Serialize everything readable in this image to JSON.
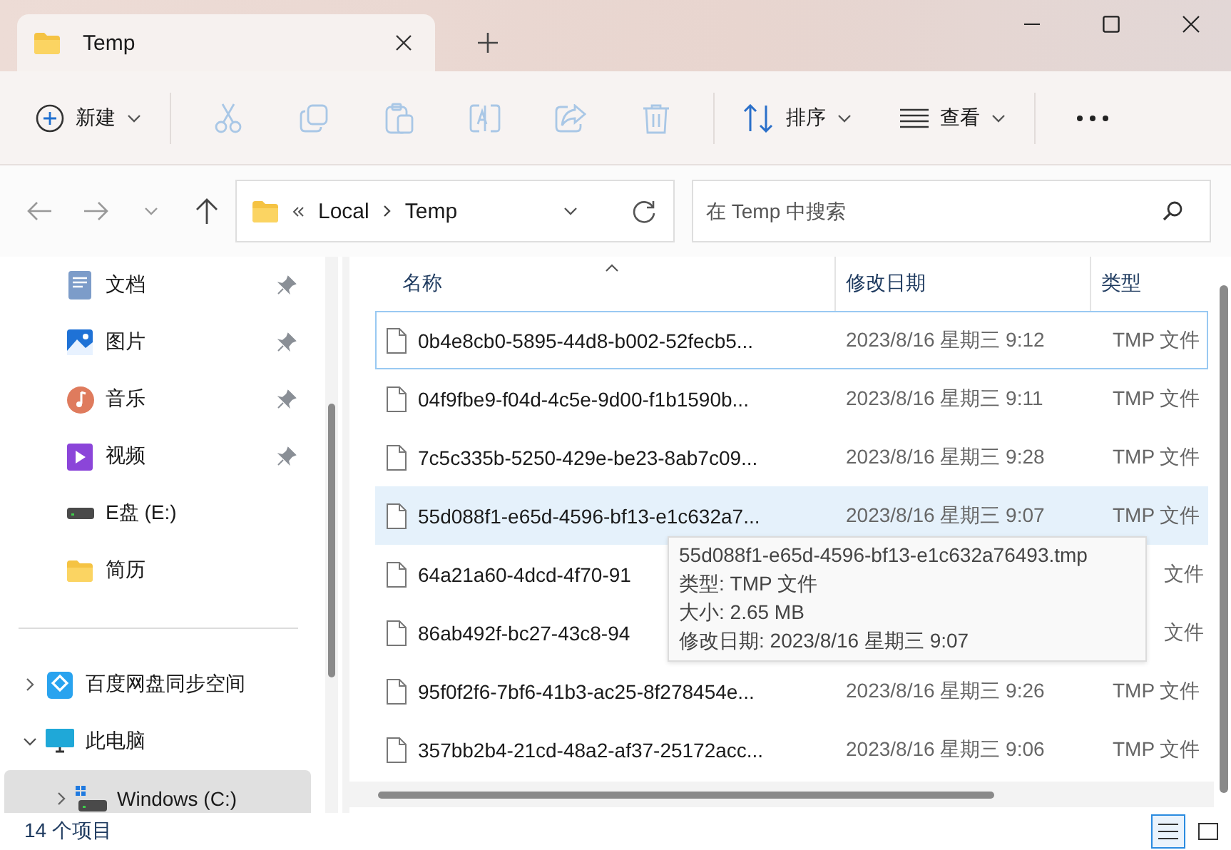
{
  "tabs": [
    {
      "label": "Temp",
      "selected": true
    }
  ],
  "toolbar": {
    "new": {
      "label": "新建"
    },
    "actions": [
      {
        "kind": "cut",
        "disabled": true
      },
      {
        "kind": "copy",
        "disabled": true
      },
      {
        "kind": "paste",
        "disabled": true
      },
      {
        "kind": "rename",
        "disabled": true
      },
      {
        "kind": "share",
        "disabled": true
      },
      {
        "kind": "delete",
        "disabled": true
      }
    ],
    "sort": {
      "label": "排序"
    },
    "view": {
      "label": "查看"
    }
  },
  "address": {
    "crumbs": [
      "Local",
      "Temp"
    ]
  },
  "search": {
    "placeholder": "在 Temp 中搜索"
  },
  "sidebar": {
    "groups": [
      {
        "items": [
          {
            "kind": "documents",
            "label": "文档",
            "pinned": true,
            "selected": false
          },
          {
            "kind": "pictures",
            "label": "图片",
            "pinned": true,
            "selected": false
          },
          {
            "kind": "music",
            "label": "音乐",
            "pinned": true,
            "selected": false
          },
          {
            "kind": "videos",
            "label": "视频",
            "pinned": true,
            "selected": false
          },
          {
            "kind": "drive",
            "label": "E盘 (E:)",
            "pinned": false,
            "selected": false
          },
          {
            "kind": "folder",
            "label": "简历",
            "pinned": false,
            "selected": false
          }
        ]
      },
      {
        "items": [
          {
            "kind": "cloud",
            "label": "百度网盘同步空间",
            "expanded": false,
            "selected": false
          },
          {
            "kind": "computer",
            "label": "此电脑",
            "expanded": true,
            "selected": false,
            "children": [
              {
                "kind": "windows-drive",
                "label": "Windows (C:)",
                "expanded": false,
                "selected": true
              }
            ]
          }
        ]
      }
    ]
  },
  "columns": [
    {
      "label": "名称",
      "sorted": true
    },
    {
      "label": "修改日期",
      "sorted": false
    },
    {
      "label": "类型",
      "sorted": false
    }
  ],
  "rows": [
    {
      "name": "0b4e8cb0-5895-44d8-b002-52fecb5...",
      "date": "2023/8/16 星期三 9:12",
      "type": "TMP 文件",
      "focused": true,
      "hovered": false
    },
    {
      "name": "04f9fbe9-f04d-4c5e-9d00-f1b1590b...",
      "date": "2023/8/16 星期三 9:11",
      "type": "TMP 文件",
      "focused": false,
      "hovered": false
    },
    {
      "name": "7c5c335b-5250-429e-be23-8ab7c09...",
      "date": "2023/8/16 星期三 9:28",
      "type": "TMP 文件",
      "focused": false,
      "hovered": false
    },
    {
      "name": "55d088f1-e65d-4596-bf13-e1c632a7...",
      "date": "2023/8/16 星期三 9:07",
      "type": "TMP 文件",
      "focused": false,
      "hovered": true
    },
    {
      "name": "64a21a60-4dcd-4f70-91",
      "type": "文件",
      "focused": false,
      "hovered": false
    },
    {
      "name": "86ab492f-bc27-43c8-94",
      "type": "文件",
      "focused": false,
      "hovered": false
    },
    {
      "name": "95f0f2f6-7bf6-41b3-ac25-8f278454e...",
      "date": "2023/8/16 星期三 9:26",
      "type": "TMP 文件",
      "focused": false,
      "hovered": false
    },
    {
      "name": "357bb2b4-21cd-48a2-af37-25172acc...",
      "date": "2023/8/16 星期三 9:06",
      "type": "TMP 文件",
      "focused": false,
      "hovered": false
    }
  ],
  "tooltip": {
    "lines": [
      "55d088f1-e65d-4596-bf13-e1c632a76493.tmp",
      "类型: TMP 文件",
      "大小: 2.65 MB",
      "修改日期: 2023/8/16 星期三 9:07"
    ]
  },
  "status_bar": {
    "count": "14 个项目",
    "views": [
      {
        "kind": "details",
        "selected": true
      },
      {
        "kind": "tiles",
        "selected": false
      }
    ]
  }
}
